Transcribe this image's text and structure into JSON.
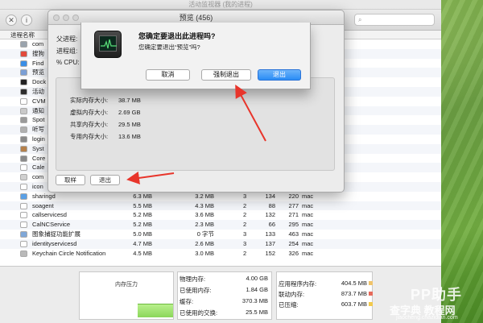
{
  "activity_monitor": {
    "title": "活动监视器 (我的进程)",
    "column_header": "进程名称",
    "processes": [
      {
        "name": "com",
        "icon_color": "#9aa3ad"
      },
      {
        "name": "搜狗",
        "icon_color": "#e24a3b"
      },
      {
        "name": "Find",
        "icon_color": "#3a8ee6"
      },
      {
        "name": "预览",
        "icon_color": "#7a9fd6"
      },
      {
        "name": "Dock",
        "icon_color": "#222222"
      },
      {
        "name": "活动",
        "icon_color": "#2e2e2e"
      },
      {
        "name": "CVM",
        "icon_color": "#ffffff"
      },
      {
        "name": "通知",
        "icon_color": "#c9c9c9"
      },
      {
        "name": "Spot",
        "icon_color": "#9a9a9a"
      },
      {
        "name": "听写",
        "icon_color": "#b0b0b0"
      },
      {
        "name": "login",
        "icon_color": "#8a8a8a"
      },
      {
        "name": "Syst",
        "icon_color": "#b5804a"
      },
      {
        "name": "Core",
        "icon_color": "#8a8a8a"
      },
      {
        "name": "Cale",
        "icon_color": "#ffffff"
      },
      {
        "name": "com",
        "icon_color": "#d0d0d0"
      },
      {
        "name": "icon",
        "icon_color": "#ffffff"
      },
      {
        "name": "sharingd",
        "mem": "6.3 MB",
        "compressed": "3.2 MB",
        "threads": "3",
        "ports": "134",
        "pid": "220",
        "user": "mac",
        "icon_color": "#5aa0e6"
      },
      {
        "name": "soagent",
        "mem": "5.5 MB",
        "compressed": "4.3 MB",
        "threads": "2",
        "ports": "88",
        "pid": "277",
        "user": "mac",
        "icon_color": "#ffffff"
      },
      {
        "name": "callservicesd",
        "mem": "5.2 MB",
        "compressed": "3.6 MB",
        "threads": "2",
        "ports": "132",
        "pid": "271",
        "user": "mac",
        "icon_color": "#ffffff"
      },
      {
        "name": "CalNCService",
        "mem": "5.2 MB",
        "compressed": "2.3 MB",
        "threads": "2",
        "ports": "66",
        "pid": "295",
        "user": "mac",
        "icon_color": "#ffffff"
      },
      {
        "name": "图象捕捉功能扩展",
        "mem": "5.0 MB",
        "compressed": "0 字节",
        "threads": "3",
        "ports": "133",
        "pid": "463",
        "user": "mac",
        "icon_color": "#7fa7d8"
      },
      {
        "name": "identityservicesd",
        "mem": "4.7 MB",
        "compressed": "2.6 MB",
        "threads": "3",
        "ports": "137",
        "pid": "254",
        "user": "mac",
        "icon_color": "#ffffff"
      },
      {
        "name": "Keychain Circle Notification",
        "mem": "4.5 MB",
        "compressed": "3.0 MB",
        "threads": "2",
        "ports": "152",
        "pid": "326",
        "user": "mac",
        "icon_color": "#b9b9b9"
      }
    ]
  },
  "memory_panel": {
    "pressure_title": "内存压力",
    "pressure_level": 0.3,
    "stats": [
      {
        "label": "物理内存:",
        "value": "4.00 GB"
      },
      {
        "label": "已使用内存:",
        "value": "1.84 GB"
      },
      {
        "label": "缓存:",
        "value": "370.3 MB"
      },
      {
        "label": "已使用的交换:",
        "value": "25.5 MB"
      }
    ],
    "app_stats": [
      {
        "label": "应用程序内存:",
        "value": "404.5 MB",
        "swatch": "#f0c36a"
      },
      {
        "label": "联动内存:",
        "value": "873.7 MB",
        "swatch": "#e66a5a"
      },
      {
        "label": "已压缩:",
        "value": "603.7 MB",
        "swatch": "#f2c94c"
      }
    ]
  },
  "info_window": {
    "title": "预览 (456)",
    "parent_label": "父进程:",
    "group_label": "进程组:",
    "cpu_label": "% CPU:",
    "memory_details": [
      {
        "label": "实际内存大小:",
        "value": "38.7 MB"
      },
      {
        "label": "虚拟内存大小:",
        "value": "2.69 GB"
      },
      {
        "label": "共享内存大小:",
        "value": "29.5 MB"
      },
      {
        "label": "专用内存大小:",
        "value": "13.6 MB"
      }
    ],
    "sample_btn": "取样",
    "quit_btn": "退出"
  },
  "dialog": {
    "title": "您确定要退出此进程吗?",
    "message": "您确定要退出“预览”吗?",
    "cancel": "取消",
    "force_quit": "强制退出",
    "quit": "退出"
  },
  "watermark": {
    "logo": "PP助手",
    "site": "查字典 教程网",
    "url": "jiaocheng.chazidian.com"
  }
}
